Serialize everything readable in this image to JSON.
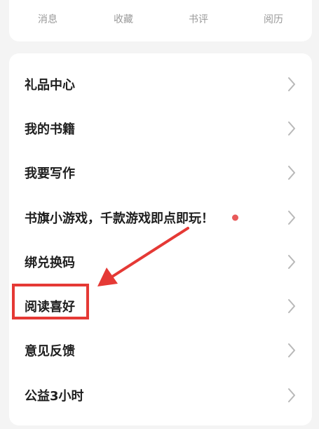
{
  "quick_nav": {
    "items": [
      {
        "label": "消息",
        "icon": "message-icon"
      },
      {
        "label": "收藏",
        "icon": "bookmark-icon"
      },
      {
        "label": "书评",
        "icon": "comment-icon"
      },
      {
        "label": "阅历",
        "icon": "history-clock-icon"
      }
    ]
  },
  "menu": {
    "items": [
      {
        "label": "礼品中心"
      },
      {
        "label": "我的书籍"
      },
      {
        "label": "我要写作"
      },
      {
        "label": "书旗小游戏，千款游戏即点即玩！"
      },
      {
        "label": "绑兑换码"
      },
      {
        "label": "阅读喜好"
      },
      {
        "label": "意见反馈"
      },
      {
        "label": "公益3小时"
      }
    ]
  },
  "colors": {
    "badge": "#e85a5a",
    "annotation": "#e53935",
    "chevron": "#b8b8b8",
    "icon": "#555555"
  }
}
